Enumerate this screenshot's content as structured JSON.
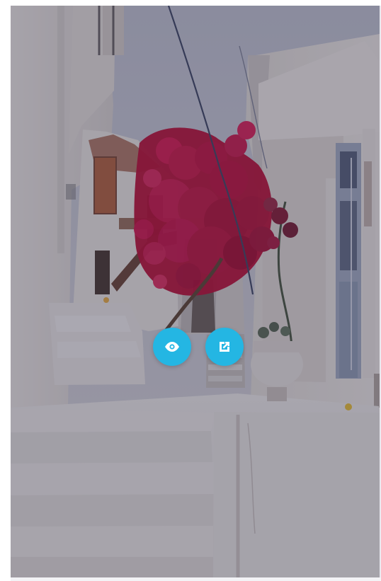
{
  "gallery_item": {
    "accent_color": "#24b6e3",
    "overlay_color": "rgba(40, 38, 62, 0.38)",
    "view_icon": "eye-icon",
    "open_icon": "external-link-icon"
  }
}
